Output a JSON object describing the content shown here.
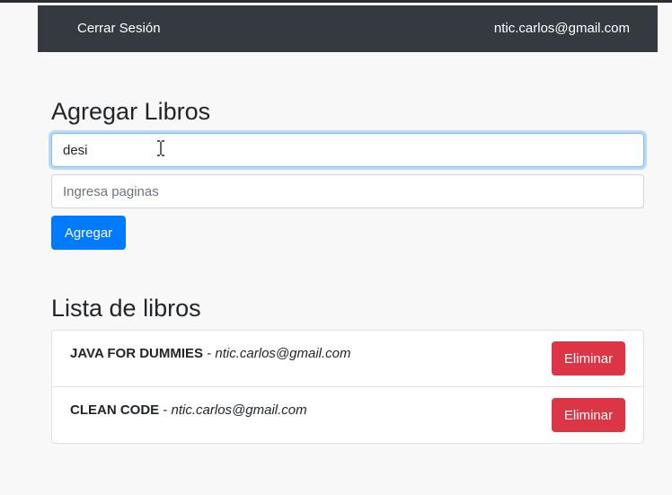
{
  "navbar": {
    "logout_label": "Cerrar Sesión",
    "user_email": "ntic.carlos@gmail.com",
    "bg_color": "#343a40"
  },
  "add_form": {
    "heading": "Agregar Libros",
    "title_input_value": "desi",
    "pages_input_value": "",
    "pages_placeholder": "Ingresa paginas",
    "submit_label": "Agregar",
    "accent_color": "#007bff"
  },
  "book_list": {
    "heading": "Lista de libros",
    "separator": " - ",
    "items": [
      {
        "title": "JAVA FOR DUMMIES",
        "author": "ntic.carlos@gmail.com",
        "delete_label": "Eliminar"
      },
      {
        "title": "CLEAN CODE",
        "author": "ntic.carlos@gmail.com",
        "delete_label": "Eliminar"
      }
    ],
    "delete_color": "#dc3545"
  },
  "cursor": "text-ibeam-icon"
}
